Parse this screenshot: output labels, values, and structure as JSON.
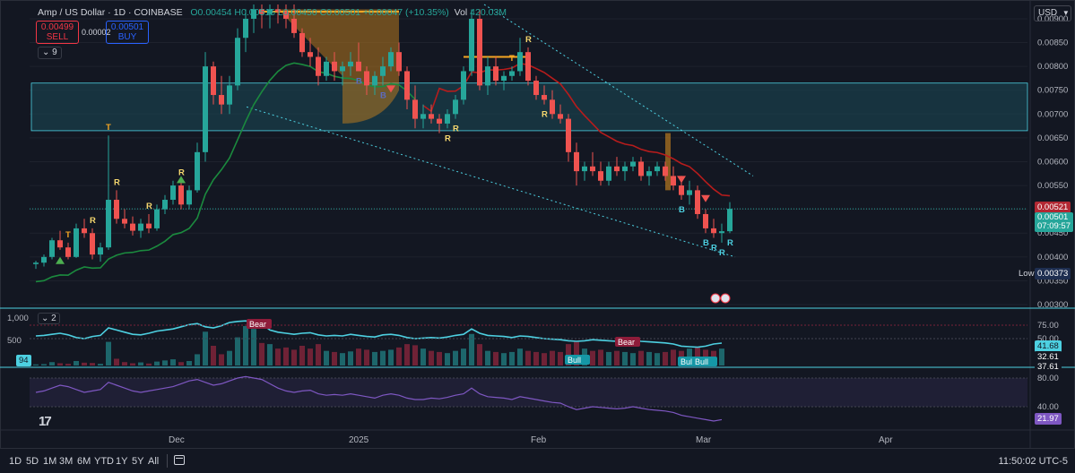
{
  "header": {
    "symbol_title": "Amp / US Dollar · 1D · COINBASE",
    "ohlc_text": "O0.00454 H0.00515 L0.00450 C0.00501 +0.00047 (+10.35%)",
    "vol_label": "Vol",
    "vol_value": "420.03M",
    "sell_price": "0.00499",
    "sell_label": "SELL",
    "spread": "0.00002",
    "buy_price": "0.00501",
    "buy_label": "BUY",
    "indicator_count": "9",
    "currency": "USD"
  },
  "price_axis": {
    "ticks": [
      "0.00900",
      "0.00850",
      "0.00800",
      "0.00750",
      "0.00700",
      "0.00650",
      "0.00600",
      "0.00550",
      "0.00500",
      "0.00450",
      "0.00400",
      "0.00350",
      "0.00300"
    ],
    "current_price": "0.00501",
    "countdown": "07:09:57",
    "ma_price": "0.00521",
    "low_label": "Low",
    "low_price": "0.00373"
  },
  "osc_pane": {
    "pane_index": "2",
    "left_ticks": [
      "1,000",
      "500"
    ],
    "right_ticks": [
      "75.00",
      "50.00"
    ],
    "value_main": "41.68",
    "value_2": "32.61",
    "value_3": "37.61",
    "left_value": "94",
    "labels": [
      "Bear",
      "Bear",
      "Bull",
      "Bull",
      "Bull"
    ]
  },
  "rsi_pane": {
    "right_ticks": [
      "80.00",
      "40.00"
    ],
    "value": "21.97"
  },
  "time_axis": {
    "labels": [
      "Dec",
      "2025",
      "Feb",
      "Mar",
      "Apr"
    ]
  },
  "bottom_bar": {
    "timeframes": [
      "1D",
      "5D",
      "1M",
      "3M",
      "6M",
      "YTD",
      "1Y",
      "5Y",
      "All"
    ],
    "clock": "11:50:02 UTC-5"
  },
  "colors": {
    "up": "#26a69a",
    "down": "#ef5350",
    "ma": "#1b8a3e",
    "ma_bear": "#b71c1c",
    "zone": "#1b4a57",
    "highlight": "#f5a623",
    "cyan": "#4dd0e1"
  },
  "chart_data": {
    "type": "candlestick",
    "title": "Amp / US Dollar · 1D · COINBASE",
    "ylim": [
      0.003,
      0.0093
    ],
    "x_range": [
      "Nov 2024",
      "Apr 2025"
    ],
    "annotation_letters": [
      "T",
      "R",
      "R",
      "R",
      "R",
      "T",
      "T",
      "R",
      "B",
      "B",
      "R",
      "R",
      "R",
      "B",
      "B",
      "R",
      "R",
      "R"
    ],
    "current_price": 0.00501,
    "low": 0.00373,
    "candles": [
      [
        0.00385,
        0.00392,
        0.00375,
        0.00388
      ],
      [
        0.00388,
        0.00405,
        0.0038,
        0.004
      ],
      [
        0.004,
        0.0044,
        0.00395,
        0.00435
      ],
      [
        0.00435,
        0.00455,
        0.00415,
        0.0042
      ],
      [
        0.0042,
        0.0043,
        0.00395,
        0.004
      ],
      [
        0.004,
        0.0047,
        0.00398,
        0.0046
      ],
      [
        0.0046,
        0.0048,
        0.0044,
        0.0045
      ],
      [
        0.0045,
        0.0046,
        0.00395,
        0.00405
      ],
      [
        0.00405,
        0.0043,
        0.0039,
        0.0042
      ],
      [
        0.0042,
        0.00655,
        0.00415,
        0.0052
      ],
      [
        0.0052,
        0.0054,
        0.0047,
        0.0048
      ],
      [
        0.0048,
        0.005,
        0.0046,
        0.0047
      ],
      [
        0.0047,
        0.00485,
        0.00445,
        0.00455
      ],
      [
        0.00455,
        0.0048,
        0.0044,
        0.0047
      ],
      [
        0.0047,
        0.0049,
        0.0045,
        0.0046
      ],
      [
        0.0046,
        0.0051,
        0.00455,
        0.005
      ],
      [
        0.005,
        0.0053,
        0.0049,
        0.0052
      ],
      [
        0.0052,
        0.0056,
        0.0051,
        0.0055
      ],
      [
        0.0055,
        0.0056,
        0.005,
        0.0051
      ],
      [
        0.0051,
        0.0055,
        0.005,
        0.0054
      ],
      [
        0.0054,
        0.0064,
        0.00535,
        0.0062
      ],
      [
        0.0062,
        0.0083,
        0.006,
        0.008
      ],
      [
        0.008,
        0.0081,
        0.0072,
        0.0074
      ],
      [
        0.0074,
        0.0078,
        0.007,
        0.0072
      ],
      [
        0.0072,
        0.0078,
        0.007,
        0.0076
      ],
      [
        0.0076,
        0.0088,
        0.0075,
        0.0086
      ],
      [
        0.0086,
        0.0092,
        0.0083,
        0.009
      ],
      [
        0.009,
        0.0093,
        0.0087,
        0.0092
      ],
      [
        0.0092,
        0.0093,
        0.0088,
        0.0091
      ],
      [
        0.0091,
        0.0093,
        0.0088,
        0.0092
      ],
      [
        0.0092,
        0.0093,
        0.0089,
        0.00915
      ],
      [
        0.00915,
        0.0093,
        0.0088,
        0.009
      ],
      [
        0.009,
        0.0093,
        0.0086,
        0.0087
      ],
      [
        0.0087,
        0.0088,
        0.0082,
        0.0083
      ],
      [
        0.0083,
        0.0086,
        0.008,
        0.0082
      ],
      [
        0.0082,
        0.0084,
        0.0076,
        0.0078
      ],
      [
        0.0078,
        0.0082,
        0.0077,
        0.0081
      ],
      [
        0.0081,
        0.0083,
        0.0077,
        0.0079
      ],
      [
        0.0079,
        0.0081,
        0.0076,
        0.008
      ],
      [
        0.008,
        0.0083,
        0.0078,
        0.0081
      ],
      [
        0.0081,
        0.0085,
        0.0079,
        0.0079
      ],
      [
        0.0079,
        0.008,
        0.0074,
        0.0076
      ],
      [
        0.0076,
        0.0079,
        0.0074,
        0.0078
      ],
      [
        0.0078,
        0.0082,
        0.0076,
        0.008
      ],
      [
        0.008,
        0.0084,
        0.0079,
        0.0083
      ],
      [
        0.0083,
        0.0085,
        0.0078,
        0.0079
      ],
      [
        0.0079,
        0.008,
        0.0071,
        0.0073
      ],
      [
        0.0073,
        0.0076,
        0.0067,
        0.0069
      ],
      [
        0.0069,
        0.0072,
        0.0067,
        0.007
      ],
      [
        0.007,
        0.0072,
        0.0068,
        0.0069
      ],
      [
        0.0069,
        0.007,
        0.0066,
        0.0068
      ],
      [
        0.0068,
        0.0071,
        0.0067,
        0.007
      ],
      [
        0.007,
        0.0074,
        0.0069,
        0.0073
      ],
      [
        0.0073,
        0.008,
        0.0072,
        0.0079
      ],
      [
        0.0079,
        0.0092,
        0.0078,
        0.009
      ],
      [
        0.009,
        0.0092,
        0.0075,
        0.0076
      ],
      [
        0.0076,
        0.0082,
        0.0074,
        0.008
      ],
      [
        0.008,
        0.0082,
        0.0076,
        0.0077
      ],
      [
        0.0077,
        0.0079,
        0.0075,
        0.0078
      ],
      [
        0.0078,
        0.008,
        0.0077,
        0.0079
      ],
      [
        0.0079,
        0.0086,
        0.0078,
        0.0083
      ],
      [
        0.0083,
        0.0084,
        0.0076,
        0.0077
      ],
      [
        0.0077,
        0.0078,
        0.0073,
        0.0074
      ],
      [
        0.0074,
        0.0076,
        0.0072,
        0.0073
      ],
      [
        0.0073,
        0.0075,
        0.0069,
        0.007
      ],
      [
        0.007,
        0.0072,
        0.0068,
        0.0069
      ],
      [
        0.0069,
        0.007,
        0.006,
        0.0062
      ],
      [
        0.0062,
        0.0064,
        0.0055,
        0.0058
      ],
      [
        0.0058,
        0.006,
        0.0056,
        0.0059
      ],
      [
        0.0059,
        0.0062,
        0.0057,
        0.0058
      ],
      [
        0.0058,
        0.006,
        0.0055,
        0.0056
      ],
      [
        0.0056,
        0.006,
        0.0055,
        0.0059
      ],
      [
        0.0059,
        0.0061,
        0.0057,
        0.0058
      ],
      [
        0.0058,
        0.006,
        0.0056,
        0.0059
      ],
      [
        0.0059,
        0.0061,
        0.0058,
        0.006
      ],
      [
        0.006,
        0.0061,
        0.0056,
        0.0057
      ],
      [
        0.0057,
        0.0059,
        0.0055,
        0.0058
      ],
      [
        0.0058,
        0.006,
        0.0057,
        0.0059
      ],
      [
        0.0059,
        0.006,
        0.0056,
        0.0057
      ],
      [
        0.0057,
        0.0059,
        0.0054,
        0.0055
      ],
      [
        0.0055,
        0.0057,
        0.0052,
        0.0053
      ],
      [
        0.0053,
        0.0056,
        0.0051,
        0.0054
      ],
      [
        0.0054,
        0.0055,
        0.0048,
        0.0049
      ],
      [
        0.0049,
        0.005,
        0.0045,
        0.0046
      ],
      [
        0.0046,
        0.0048,
        0.0044,
        0.0045
      ],
      [
        0.0045,
        0.0047,
        0.0043,
        0.00454
      ],
      [
        0.00454,
        0.00515,
        0.0045,
        0.00501
      ]
    ],
    "volume": [
      20,
      25,
      60,
      40,
      30,
      80,
      50,
      45,
      30,
      420,
      120,
      60,
      40,
      55,
      35,
      70,
      90,
      110,
      60,
      80,
      200,
      600,
      350,
      200,
      260,
      500,
      700,
      650,
      400,
      380,
      300,
      320,
      280,
      350,
      300,
      380,
      260,
      240,
      220,
      250,
      300,
      280,
      240,
      260,
      280,
      320,
      380,
      360,
      300,
      260,
      240,
      220,
      260,
      300,
      560,
      380,
      260,
      240,
      220,
      240,
      300,
      260,
      240,
      220,
      260,
      240,
      380,
      420,
      300,
      260,
      280,
      240,
      260,
      240,
      220,
      260,
      240,
      220,
      240,
      280,
      260,
      300,
      320,
      280,
      260,
      300
    ],
    "oscillator": [
      55,
      56,
      58,
      60,
      57,
      52,
      50,
      54,
      56,
      70,
      66,
      62,
      58,
      57,
      60,
      64,
      66,
      68,
      72,
      76,
      78,
      72,
      70,
      74,
      80,
      82,
      83,
      80,
      78,
      66,
      62,
      60,
      58,
      60,
      61,
      57,
      55,
      56,
      55,
      58,
      56,
      54,
      53,
      57,
      58,
      56,
      52,
      50,
      51,
      52,
      51,
      53,
      56,
      58,
      68,
      60,
      56,
      55,
      54,
      52,
      55,
      54,
      52,
      50,
      49,
      48,
      46,
      45,
      46,
      48,
      47,
      46,
      45,
      46,
      47,
      45,
      44,
      43,
      42,
      40,
      36,
      35,
      34,
      36,
      40,
      41.68
    ],
    "rsi": [
      60,
      62,
      66,
      70,
      68,
      64,
      60,
      62,
      64,
      74,
      70,
      66,
      62,
      60,
      62,
      64,
      66,
      68,
      72,
      76,
      78,
      74,
      70,
      72,
      76,
      80,
      82,
      80,
      78,
      72,
      66,
      62,
      60,
      62,
      63,
      58,
      56,
      57,
      56,
      58,
      56,
      54,
      52,
      56,
      58,
      56,
      52,
      50,
      50,
      52,
      51,
      53,
      56,
      58,
      66,
      58,
      54,
      53,
      52,
      50,
      54,
      52,
      50,
      48,
      46,
      45,
      40,
      36,
      38,
      40,
      39,
      38,
      37,
      38,
      40,
      38,
      36,
      35,
      34,
      32,
      28,
      26,
      24,
      22,
      20,
      21.97
    ]
  }
}
